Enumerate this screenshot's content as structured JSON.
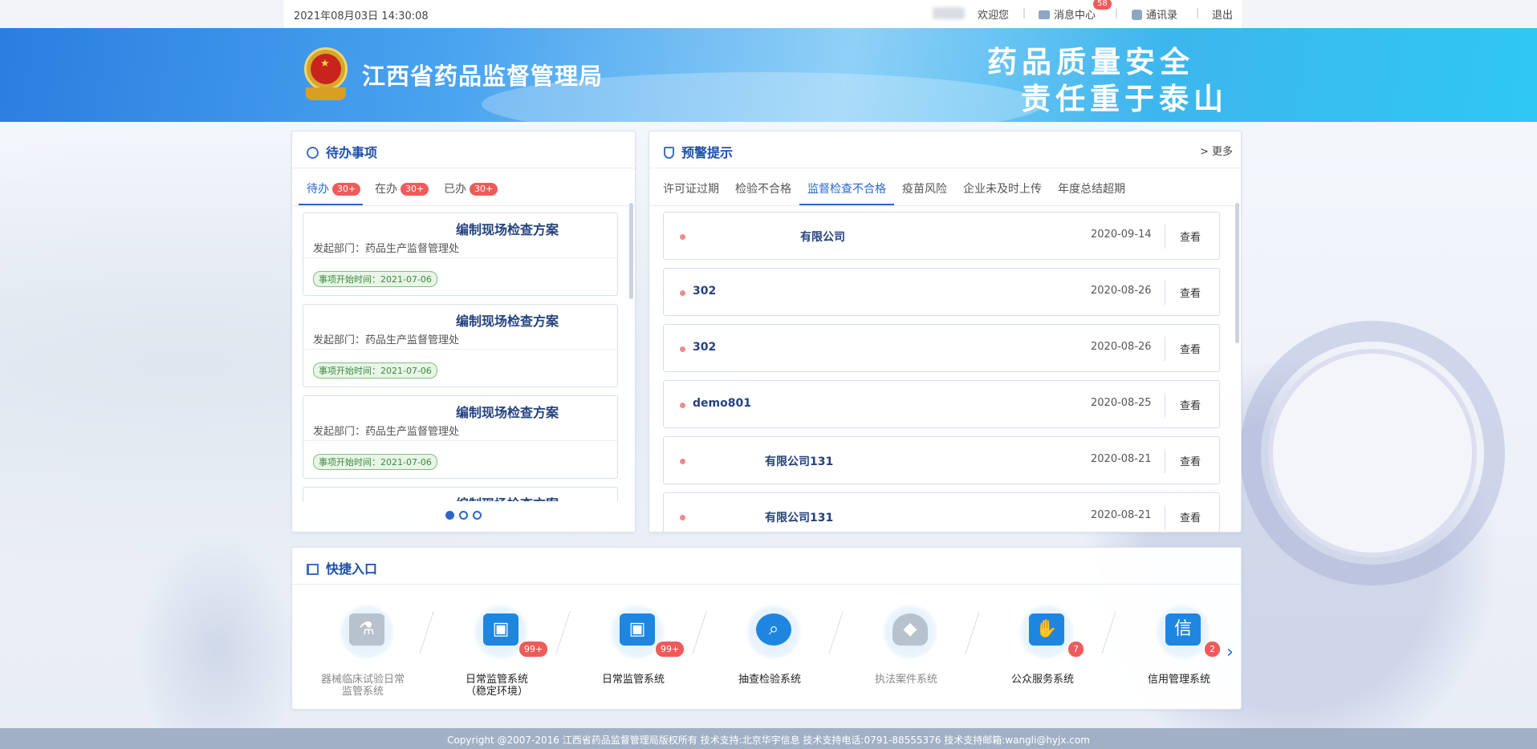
{
  "topbar": {
    "datetime": "2021年08月03日 14:30:08",
    "welcome": "欢迎您",
    "message_center": "消息中心",
    "message_count": "58",
    "contacts": "通讯录",
    "logout": "退出"
  },
  "banner": {
    "bureau_name": "江西省药品监督管理局",
    "slogan_line1": "药品质量安全",
    "slogan_line2": "责任重于泰山"
  },
  "todo": {
    "title": "待办事项",
    "tabs": [
      {
        "label": "待办",
        "badge": "30+"
      },
      {
        "label": "在办",
        "badge": "30+"
      },
      {
        "label": "已办",
        "badge": "30+"
      }
    ],
    "items": [
      {
        "title": "编制现场检查方案",
        "dept": "发起部门：药品生产监督管理处",
        "tag": "事项开始时间：2021-07-06"
      },
      {
        "title": "编制现场检查方案",
        "dept": "发起部门：药品生产监督管理处",
        "tag": "事项开始时间：2021-07-06"
      },
      {
        "title": "编制现场检查方案",
        "dept": "发起部门：药品生产监督管理处",
        "tag": "事项开始时间：2021-07-06"
      },
      {
        "title": "编制现场检查方案",
        "dept": "",
        "tag": ""
      }
    ]
  },
  "warning": {
    "title": "预警提示",
    "more": "> 更多",
    "tabs": [
      "许可证过期",
      "检验不合格",
      "监督检查不合格",
      "疫苗风险",
      "企业未及时上传",
      "年度总结超期"
    ],
    "active_tab": "监督检查不合格",
    "rows": [
      {
        "name": "有限公司",
        "date": "2020-09-14",
        "action": "查看"
      },
      {
        "name": "302",
        "date": "2020-08-26",
        "action": "查看"
      },
      {
        "name": "302",
        "date": "2020-08-26",
        "action": "查看"
      },
      {
        "name": "demo801",
        "date": "2020-08-25",
        "action": "查看"
      },
      {
        "name": "有限公司131",
        "date": "2020-08-21",
        "action": "查看"
      },
      {
        "name": "有限公司131",
        "date": "2020-08-21",
        "action": "查看"
      }
    ]
  },
  "quick": {
    "title": "快捷入口",
    "items": [
      {
        "label": "器械临床试验日常监管系统",
        "icon": "microscope-icon",
        "badge": "",
        "enabled": false
      },
      {
        "label": "日常监管系统（稳定环境）",
        "icon": "monitor-shield-icon",
        "badge": "99+",
        "enabled": true
      },
      {
        "label": "日常监管系统",
        "icon": "monitor-shield-icon",
        "badge": "99+",
        "enabled": true
      },
      {
        "label": "抽查检验系统",
        "icon": "magnifier-icon",
        "badge": "",
        "enabled": true
      },
      {
        "label": "执法案件系统",
        "icon": "police-cap-icon",
        "badge": "",
        "enabled": false
      },
      {
        "label": "公众服务系统",
        "icon": "handshake-icon",
        "badge": "7",
        "enabled": true
      },
      {
        "label": "信用管理系统",
        "icon": "credit-card-icon",
        "badge": "2",
        "enabled": true
      }
    ]
  },
  "footer": {
    "text": "Copyright @2007-2016 江西省药品监督管理局版权所有 技术支持:北京华宇信息 技术支持电话:0791-88555376 技术支持邮箱:wangli@hyjx.com"
  },
  "colors": {
    "accent": "#2a67c9",
    "badge_red": "#ef5b5b",
    "title_blue": "#1e4fa8",
    "footer_bg": "#a2b0c6"
  }
}
